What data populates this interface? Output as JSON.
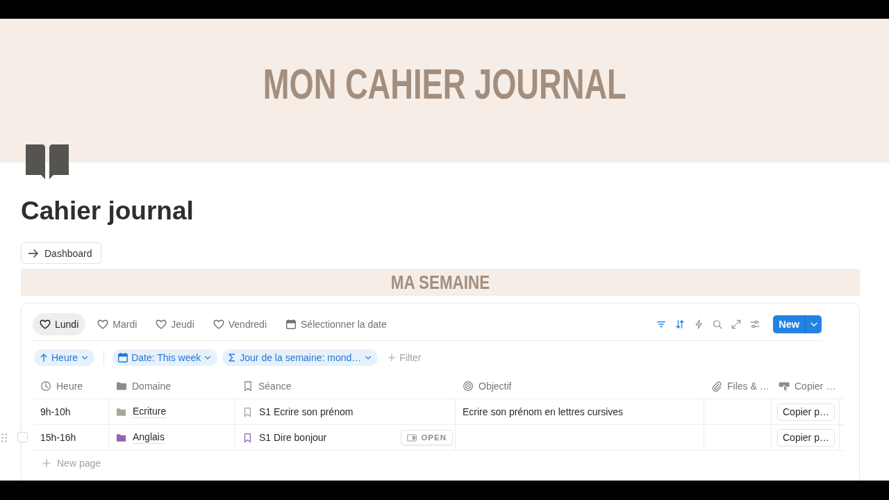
{
  "cover": {
    "title": "MON CAHIER JOURNAL"
  },
  "page": {
    "title": "Cahier journal",
    "link": "Dashboard"
  },
  "section": {
    "title": "MA SEMAINE"
  },
  "tabs": [
    {
      "kind": "day",
      "label": "Lundi",
      "selected": true
    },
    {
      "kind": "day",
      "label": "Mardi",
      "selected": false
    },
    {
      "kind": "day",
      "label": "Jeudi",
      "selected": false
    },
    {
      "kind": "day",
      "label": "Vendredi",
      "selected": false
    },
    {
      "kind": "date",
      "label": "Sélectionner la date",
      "selected": false
    }
  ],
  "toolbar": [
    {
      "kind": "filter",
      "active": true
    },
    {
      "kind": "sort",
      "active": true
    },
    {
      "kind": "automation",
      "active": false
    },
    {
      "kind": "search",
      "active": false
    },
    {
      "kind": "expand",
      "active": false
    },
    {
      "kind": "settings",
      "active": false
    }
  ],
  "new_button": {
    "label": "New"
  },
  "filters": [
    {
      "kind": "sort",
      "label": "Heure"
    },
    {
      "kind": "date",
      "label": "Date: This week"
    },
    {
      "kind": "formula",
      "label": "Jour de la semaine: mond…"
    }
  ],
  "add_filter": "Filter",
  "columns": [
    {
      "kind": "time",
      "label": "Heure"
    },
    {
      "kind": "folder",
      "label": "Domaine"
    },
    {
      "kind": "bookmark",
      "label": "Séance"
    },
    {
      "kind": "target",
      "label": "Objectif"
    },
    {
      "kind": "files",
      "label": "Files & …"
    },
    {
      "kind": "button",
      "label": "Copier …"
    }
  ],
  "rows": [
    {
      "hovered": false,
      "checked": false,
      "heure": "9h-10h",
      "domaine": {
        "label": "Ecriture",
        "color": "#aca59d"
      },
      "seance": {
        "label": "S1 Ecrire son prénom",
        "color": "#a3a29e"
      },
      "objectif": "Ecrire son prénom en lettres cursives",
      "copier": "Copier p…"
    },
    {
      "hovered": true,
      "checked": false,
      "open_button": "OPEN",
      "heure": "15h-16h",
      "domaine": {
        "label": "Anglais",
        "color": "#9065b0"
      },
      "seance": {
        "label": "S1 Dire bonjour",
        "color": "#9065b0"
      },
      "copier": "Copier p…"
    }
  ],
  "new_page": "New page"
}
